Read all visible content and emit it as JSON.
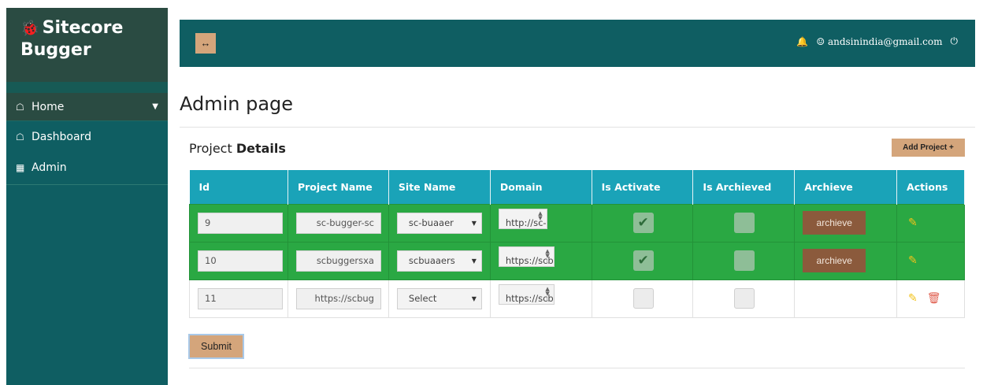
{
  "brand": {
    "line1": "Sitecore",
    "line2": "Bugger",
    "icon": "bug-icon"
  },
  "sidebar": {
    "items": [
      {
        "label": "Home",
        "icon": "home-icon"
      },
      {
        "label": "Dashboard",
        "icon": "home-icon"
      },
      {
        "label": "Admin",
        "icon": "id-card-icon"
      }
    ]
  },
  "topbar": {
    "toggle_label": "↔",
    "user_email": "andsinindia@gmail.com"
  },
  "page": {
    "title": "Admin page",
    "section_prefix": "Project",
    "section_bold": "Details",
    "add_button": "Add Project"
  },
  "table": {
    "headers": [
      "Id",
      "Project Name",
      "Site Name",
      "Domain",
      "Is Activate",
      "Is Archieved",
      "Archieve",
      "Actions"
    ],
    "rows": [
      {
        "id": "9",
        "project_name": "sc-bugger-sc",
        "site_name": "sc-buaaer",
        "domain": "http://sc-",
        "is_activate": true,
        "is_archived": false,
        "archive_label": "archieve"
      },
      {
        "id": "10",
        "project_name": "scbuggersxa",
        "site_name": "scbuaaers",
        "domain": "https://scb",
        "is_activate": true,
        "is_archived": false,
        "archive_label": "archieve"
      },
      {
        "id": "11",
        "project_name": "https://scbug",
        "site_name": "Select",
        "domain": "https://scb",
        "is_activate": false,
        "is_archived": false,
        "archive_label": ""
      }
    ]
  },
  "submit_label": "Submit",
  "colors": {
    "sidebar": "#0f5e62",
    "accent": "#d4a57b",
    "header": "#1aa3b8",
    "active_row": "#2aa843"
  }
}
